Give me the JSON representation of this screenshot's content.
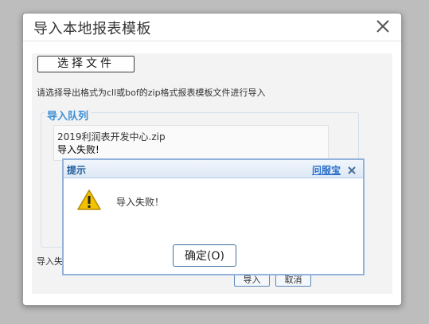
{
  "dialog": {
    "title": "导入本地报表模板"
  },
  "uploader": {
    "choose_file_label": "选择文件",
    "hint": "请选择导出格式为cll或bof的zip格式报表模板文件进行导入"
  },
  "queue": {
    "legend": "导入队列",
    "items": [
      {
        "file_name": "2019利润表开发中心.zip",
        "status": "导入失败!"
      }
    ]
  },
  "status_line": "导入失",
  "buttons": {
    "import_label": "导入",
    "cancel_label": "取消"
  },
  "alert": {
    "title": "提示",
    "help_link": "问服宝",
    "message": "导入失败！",
    "ok_label": "确定(O)",
    "icon": "warning-icon"
  },
  "colors": {
    "accent_blue": "#3b8fd6",
    "alert_border": "#93b3da",
    "warning_yellow": "#f2c200"
  }
}
